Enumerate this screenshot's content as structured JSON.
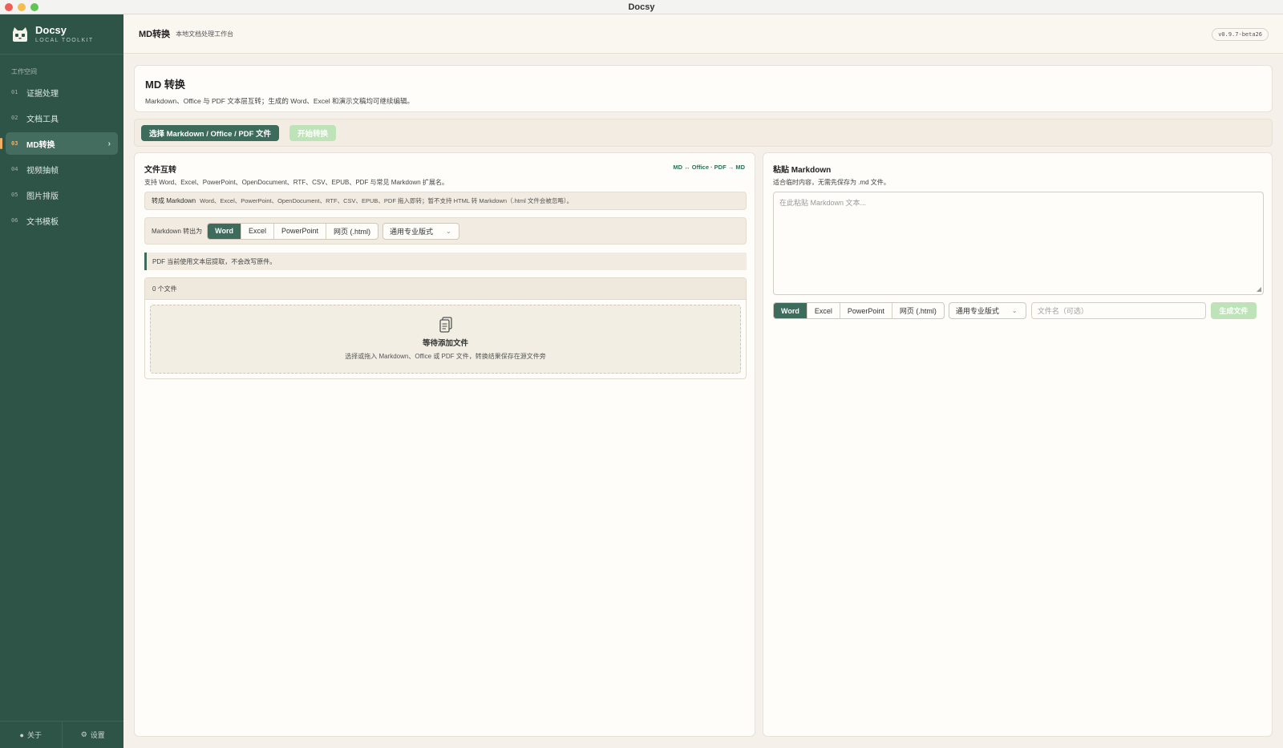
{
  "window": {
    "title": "Docsy"
  },
  "brand": {
    "name": "Docsy",
    "subtitle": "LOCAL TOOLKIT"
  },
  "sidebar": {
    "section_label": "工作空间",
    "items": [
      {
        "num": "01",
        "label": "证据处理"
      },
      {
        "num": "02",
        "label": "文档工具"
      },
      {
        "num": "03",
        "label": "MD转换",
        "active": true
      },
      {
        "num": "04",
        "label": "视频抽帧"
      },
      {
        "num": "05",
        "label": "图片排版"
      },
      {
        "num": "06",
        "label": "文书模板"
      }
    ],
    "footer": {
      "about": "关于",
      "settings": "设置"
    }
  },
  "topbar": {
    "title": "MD转换",
    "subtitle": "本地文档处理工作台",
    "version": "v0.9.7-beta26"
  },
  "page": {
    "title": "MD 转换",
    "description": "Markdown、Office 与 PDF 文本层互转；生成的 Word、Excel 和演示文稿均可继续编辑。"
  },
  "actions": {
    "select_files": "选择 Markdown / Office / PDF 文件",
    "start": "开始转换"
  },
  "file_panel": {
    "title": "文件互转",
    "subtitle": "支持 Word、Excel、PowerPoint、OpenDocument、RTF、CSV、EPUB、PDF 与常见 Markdown 扩展名。",
    "tag": "MD ↔ Office · PDF → MD",
    "to_md_label": "转成 Markdown",
    "to_md_desc": "Word、Excel、PowerPoint、OpenDocument、RTF、CSV、EPUB、PDF 拖入即转；暂不支持 HTML 转 Markdown（.html 文件会被忽略）。",
    "md_to_label": "Markdown 转出为",
    "formats": [
      "Word",
      "Excel",
      "PowerPoint",
      "网页 (.html)"
    ],
    "selected_format": "Word",
    "style_select": "通用专业版式",
    "pdf_note": "PDF 当前使用文本层提取，不会改写原件。",
    "file_count": "0 个文件",
    "empty_title": "等待添加文件",
    "empty_desc": "选择或拖入 Markdown、Office 或 PDF 文件，转换结果保存在源文件旁"
  },
  "paste_panel": {
    "title": "粘贴 Markdown",
    "subtitle": "适合临时内容，无需先保存为 .md 文件。",
    "placeholder": "在此粘贴 Markdown 文本...",
    "formats": [
      "Word",
      "Excel",
      "PowerPoint",
      "网页 (.html)"
    ],
    "selected_format": "Word",
    "style_select": "通用专业版式",
    "filename_placeholder": "文件名（可选）",
    "generate": "生成文件"
  }
}
